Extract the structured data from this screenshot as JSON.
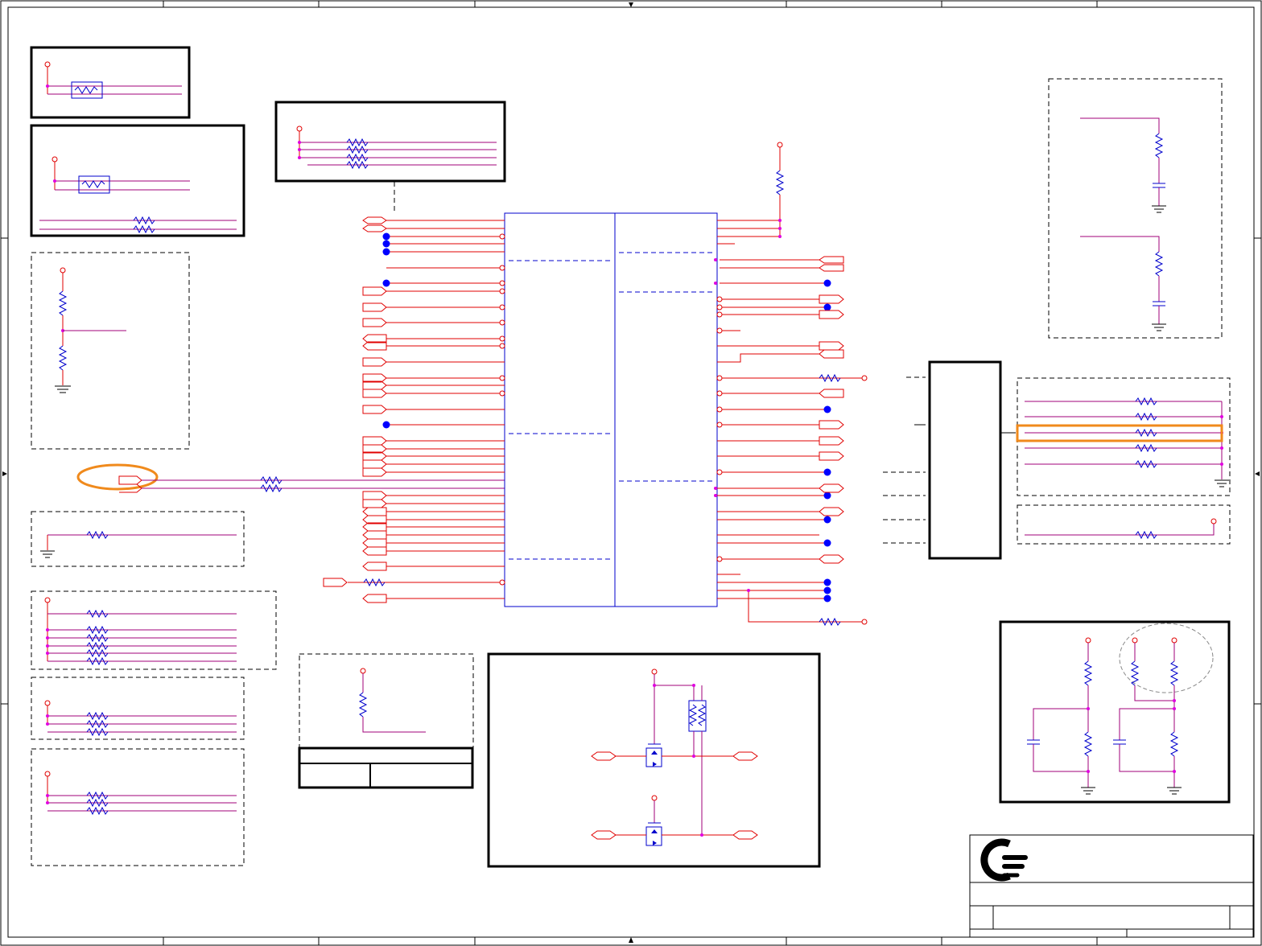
{
  "diagram": {
    "kind": "electrical-schematic",
    "colors": {
      "wire": "#e00000",
      "net": "#a0007a",
      "component": "#0000cc",
      "junction": "#e000e0",
      "no_connect": "#0000ff",
      "frame": "#000000",
      "highlight": "#f08a1c"
    },
    "icons": [
      "resistor",
      "ferrite-bead",
      "capacitor",
      "ground-symbol",
      "power-pin",
      "port-connector",
      "mosfet",
      "company-logo"
    ],
    "highlights": [
      "port-connector-left-center",
      "resistor-row-right-third"
    ],
    "title_block": {
      "logo_icon": "company-logo"
    }
  }
}
